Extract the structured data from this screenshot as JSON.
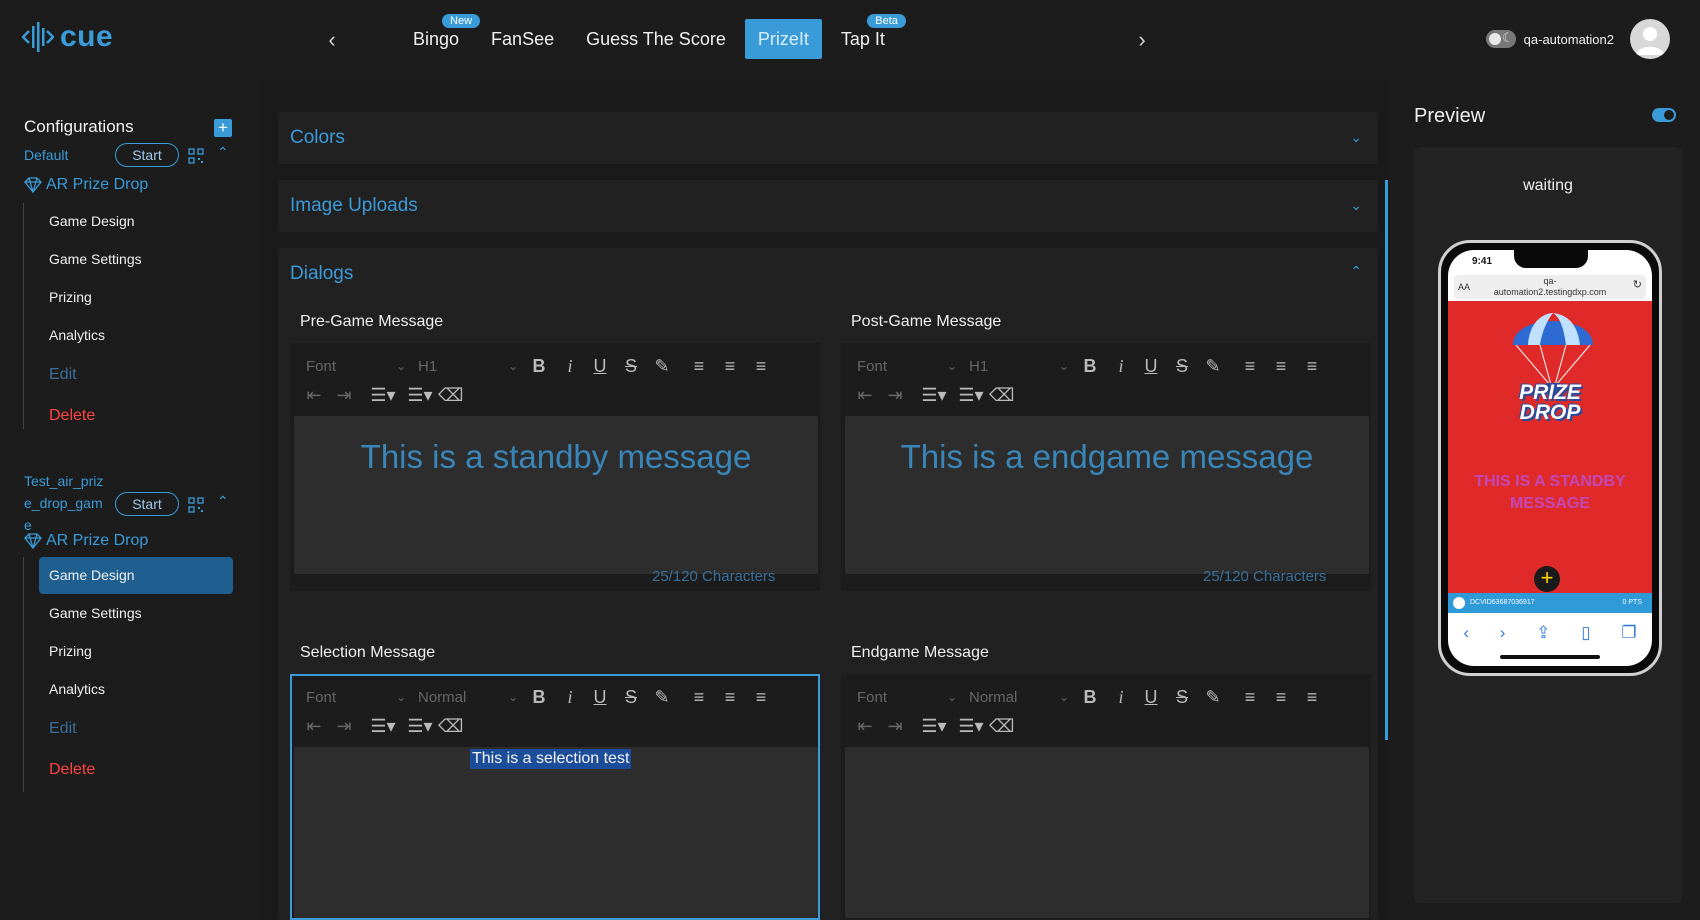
{
  "app": {
    "logo_text": "cue"
  },
  "nav": {
    "tabs": [
      {
        "label": "Bingo",
        "badge": "New",
        "active": false
      },
      {
        "label": "FanSee",
        "badge": "",
        "active": false
      },
      {
        "label": "Guess The Score",
        "badge": "",
        "active": false
      },
      {
        "label": "PrizeIt",
        "badge": "",
        "active": true
      },
      {
        "label": "Tap It",
        "badge": "Beta",
        "active": false
      }
    ],
    "prev_icon": "chevron-left-icon",
    "next_icon": "chevron-right-icon"
  },
  "user": {
    "name": "qa-automation2",
    "theme_toggle": "dark-mode-toggle"
  },
  "sidebar": {
    "title": "Configurations",
    "add_icon": "plus-icon",
    "configs": [
      {
        "name": "Default",
        "start_label": "Start",
        "game": "AR Prize Drop",
        "items": [
          "Game Design",
          "Game Settings",
          "Prizing",
          "Analytics"
        ],
        "edit_label": "Edit",
        "delete_label": "Delete",
        "active_item": ""
      },
      {
        "name_lines": [
          "Test_air_priz",
          "e_drop_gam",
          "e"
        ],
        "start_label": "Start",
        "game": "AR Prize Drop",
        "items": [
          "Game Design",
          "Game Settings",
          "Prizing",
          "Analytics"
        ],
        "edit_label": "Edit",
        "delete_label": "Delete",
        "active_item": "Game Design"
      }
    ]
  },
  "main": {
    "sections": [
      {
        "title": "Colors",
        "expanded": false
      },
      {
        "title": "Image Uploads",
        "expanded": false
      },
      {
        "title": "Dialogs",
        "expanded": true
      }
    ],
    "editors": [
      {
        "label": "Pre-Game Message",
        "font": "Font",
        "size": "H1",
        "content": "This is a standby message",
        "count": "25/120 Characters"
      },
      {
        "label": "Post-Game Message",
        "font": "Font",
        "size": "H1",
        "content": "This is a endgame message",
        "count": "25/120 Characters"
      },
      {
        "label": "Selection Message",
        "font": "Font",
        "size": "Normal",
        "content": "This is a selection test",
        "count": ""
      },
      {
        "label": "Endgame Message",
        "font": "Font",
        "size": "Normal",
        "content": "",
        "count": ""
      }
    ]
  },
  "preview": {
    "title": "Preview",
    "status": "waiting",
    "phone": {
      "time": "9:41",
      "url_prefix": "AA",
      "url_lines": [
        "qa-",
        "automation2.testingdxp.com"
      ],
      "logo_lines": [
        "PRIZE",
        "DROP"
      ],
      "message_lines": [
        "THIS IS A STANDBY",
        "MESSAGE"
      ],
      "bar_left": "DCVID63687036917",
      "bar_right": "0 PTS"
    }
  },
  "colors": {
    "accent": "#3a9bd9",
    "danger": "#ff4242",
    "active_item_bg": "#1f5f8f"
  }
}
